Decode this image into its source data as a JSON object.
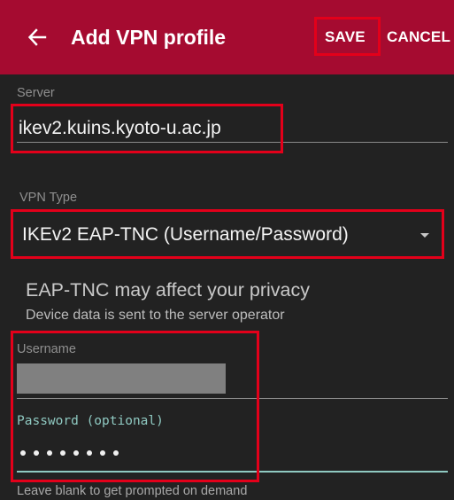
{
  "app_bar": {
    "title": "Add VPN profile",
    "save_label": "SAVE",
    "cancel_label": "CANCEL",
    "background": "#a50b30"
  },
  "server": {
    "label": "Server",
    "value": "ikev2.kuins.kyoto-u.ac.jp"
  },
  "vpn_type": {
    "label": "VPN Type",
    "selected": "IKEv2 EAP-TNC (Username/Password)"
  },
  "privacy_notice": {
    "title": "EAP-TNC may affect your privacy",
    "subtitle": "Device data is sent to the server operator"
  },
  "username": {
    "label": "Username",
    "value": ""
  },
  "password": {
    "label": "Password (optional)",
    "helper": "Leave blank to get prompted on demand",
    "masked_length": 8
  },
  "colors": {
    "highlight": "#e3001a",
    "background": "#222222",
    "focus_accent": "#8fc9c1"
  },
  "icons": {
    "back": "arrow-left-icon",
    "dropdown": "caret-down-icon"
  }
}
